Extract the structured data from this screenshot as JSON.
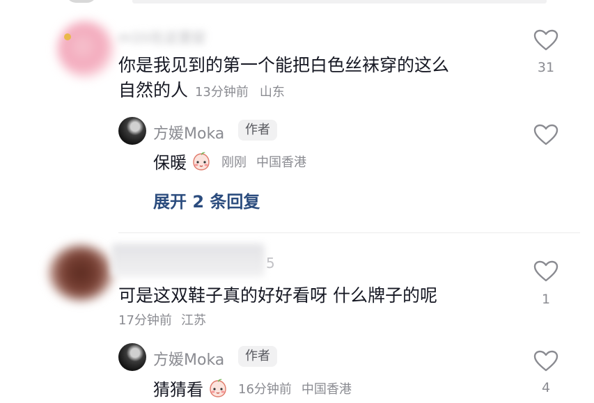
{
  "comments": [
    {
      "username": "m1ti在这里捉",
      "text_line1": "你是我见到的第一个能把白色丝袜穿的这么",
      "text_line2": "自然的人",
      "time": "13分钟前",
      "location": "山东",
      "likes": "31",
      "reply": {
        "username": "方媛Moka",
        "tag": "作者",
        "text": "保暖",
        "time": "刚刚",
        "location": "中国香港"
      },
      "expand_label": "展开 2 条回复"
    },
    {
      "username_fragment": "5",
      "text": "可是这双鞋子真的好好看呀 什么牌子的呢",
      "time": "17分钟前",
      "location": "江苏",
      "likes": "1",
      "reply": {
        "username": "方媛Moka",
        "tag": "作者",
        "text": "猜猜看",
        "time": "16分钟前",
        "location": "中国香港",
        "likes": "4"
      }
    }
  ],
  "icons": {
    "like": "heart-outline-icon",
    "sticker": "blushing-peach-sticker"
  },
  "colors": {
    "text": "#161823",
    "meta": "#8a8b91",
    "link": "#2b4c7e",
    "tag_bg": "#f1f1f2"
  }
}
